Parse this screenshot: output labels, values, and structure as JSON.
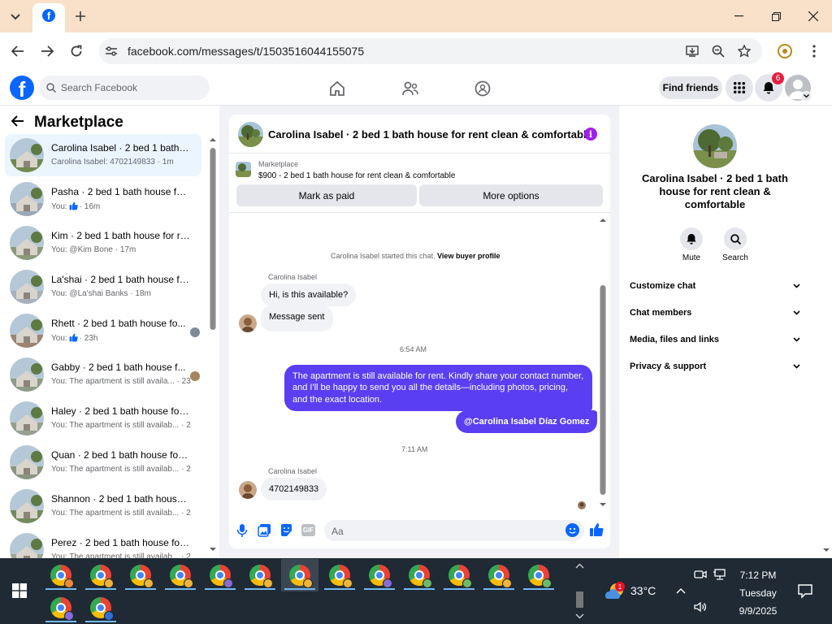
{
  "browser": {
    "url": "facebook.com/messages/t/1503516044155075"
  },
  "fb": {
    "search_placeholder": "Search Facebook",
    "find_friends": "Find friends",
    "notif_count": "6"
  },
  "sidebar": {
    "title": "Marketplace",
    "conversations": [
      {
        "title": "Carolina Isabel · 2 bed 1 bath h...",
        "preview": "Carolina Isabel: 4702149833 · 1m",
        "active": true,
        "avatar_color": "#6f8a4e"
      },
      {
        "title": "Pasha · 2 bed 1 bath house for r...",
        "preview_prefix": "You:",
        "preview": "· 16m",
        "like": true,
        "avatar_color": "#9aa8b7"
      },
      {
        "title": "Kim · 2 bed 1 bath house for re...",
        "preview": "You: @Kim Bone · 17m",
        "avatar_color": "#8b9a7b"
      },
      {
        "title": "La'shai · 2 bed 1 bath house for ...",
        "preview": "You: @La'shai Banks · 18m",
        "avatar_color": "#a7b0bd"
      },
      {
        "title": "Rhett · 2 bed 1 bath house fo...",
        "preview_prefix": "You:",
        "preview": "· 23h",
        "like": true,
        "avatar_color": "#9b8470",
        "mini_color": "#7d8a9a"
      },
      {
        "title": "Gabby · 2 bed 1 bath house f...",
        "preview": "You: The apartment is still availa... · 23h",
        "avatar_color": "#8c9b85",
        "mini_color": "#a7845e"
      },
      {
        "title": "Haley · 2 bed 1 bath house for r...",
        "preview": "You: The apartment is still availab... · 23h",
        "avatar_color": "#96a090"
      },
      {
        "title": "Quan · 2 bed 1 bath house for r...",
        "preview": "You: The apartment is still availab... · 23h",
        "avatar_color": "#8a9580"
      },
      {
        "title": "Shannon · 2 bed 1 bath house f...",
        "preview": "You: The apartment is still availab... · 23h",
        "avatar_color": "#728a5c"
      },
      {
        "title": "Perez · 2 bed 1 bath house for r...",
        "preview": "You: The apartment is still availab... · 23h",
        "avatar_color": "#9ea79a"
      }
    ]
  },
  "chat": {
    "title": "Carolina Isabel · 2 bed 1 bath house for rent clean & comfortable",
    "marketplace_label": "Marketplace",
    "listing": "$900 - 2 bed 1 bath house for rent clean & comfortable",
    "mark_paid": "Mark as paid",
    "more_options": "More options",
    "started": "Carolina Isabel started this chat.",
    "view_buyer": "View buyer profile",
    "sender_name": "Carolina Isabel",
    "msg1": "Hi, is this available?",
    "msg2": "Message sent",
    "time1": "6:54 AM",
    "reply": "The apartment is still available for rent. Kindly share your contact number, and I'll be happy to send you all the details—including photos, pricing, and the exact location.",
    "mention": "@Carolina Isabel Díaz Gomez",
    "time2": "7:11 AM",
    "sender_name2": "Carolina Isabel",
    "msg3": "4702149833",
    "composer_placeholder": "Aa"
  },
  "info": {
    "name": "Carolina Isabel · 2 bed 1 bath house for rent clean & comfortable",
    "mute": "Mute",
    "search": "Search",
    "sections": [
      "Customize chat",
      "Chat members",
      "Media, files and links",
      "Privacy & support"
    ]
  },
  "taskbar": {
    "temp": "33°C",
    "weather_badge": "1",
    "time": "7:12 PM",
    "day": "Tuesday",
    "date": "9/9/2025",
    "profile_colors": [
      "#ea8a3c",
      "#f0b43a",
      "#f0b43a",
      "#f0b43a",
      "#8a6ad8",
      "#f0b43a",
      "#f0b43a",
      "#f0b43a",
      "#8a6ad8",
      "#6fb86a",
      "#6fb86a",
      "#f0b43a",
      "#6fb86a",
      "#8a6ad8",
      "#2f6fd6"
    ]
  },
  "colors": {
    "fb_blue": "#0866ff",
    "sent_bubble": "#5a3ff2",
    "active_row": "#ebf5ff",
    "notif_red": "#e41e3f"
  }
}
